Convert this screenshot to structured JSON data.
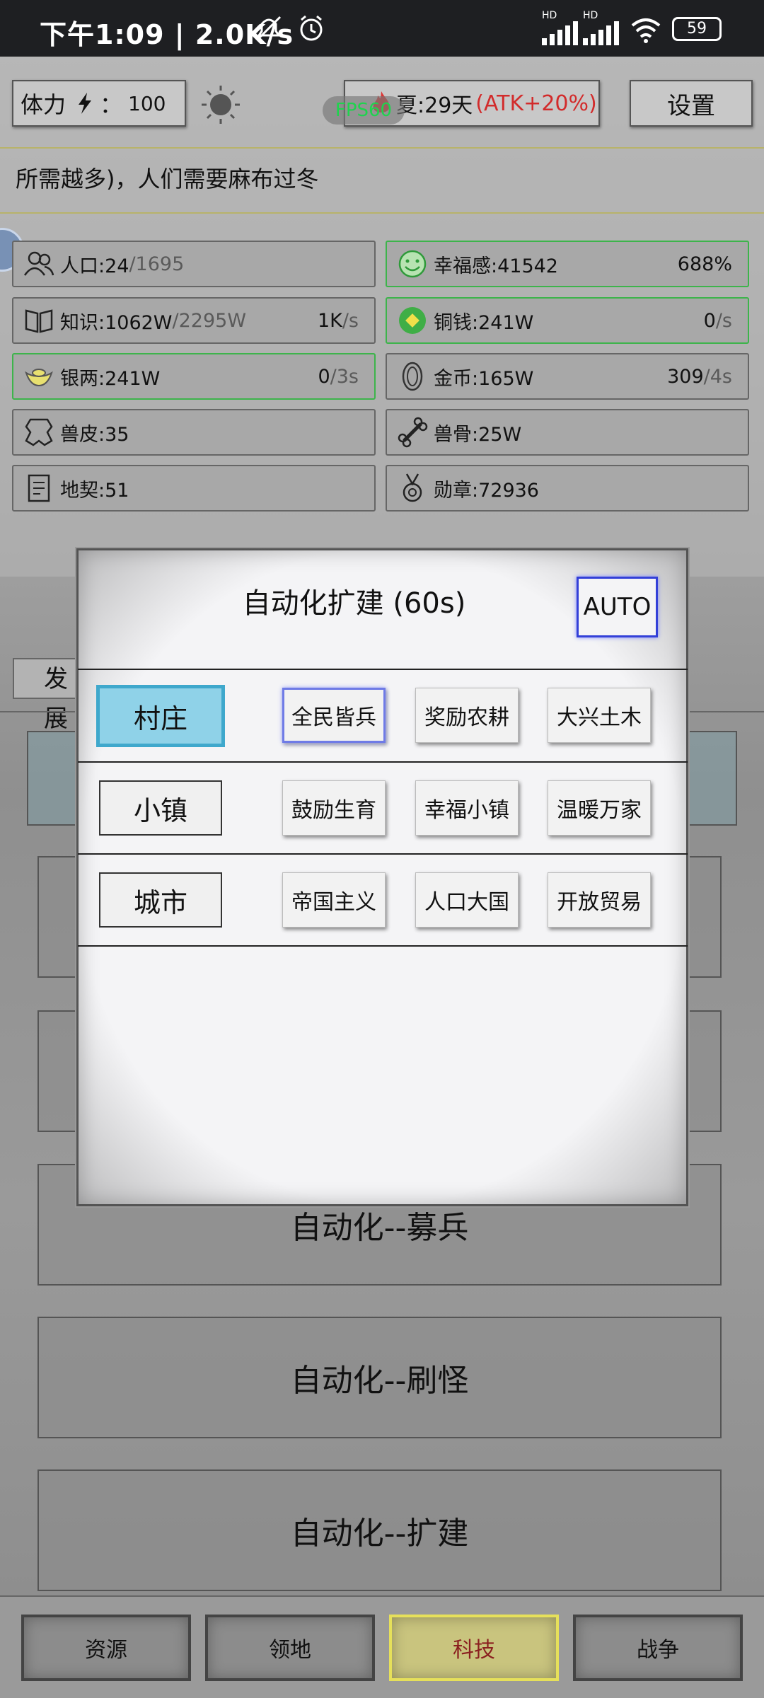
{
  "status_bar": {
    "time": "下午1:09 | 2.0K/s",
    "network_1": "HD",
    "network_2": "HD",
    "battery": "59"
  },
  "header": {
    "stamina_label": "体力",
    "stamina_sep": "：",
    "stamina_value": "100",
    "season": "夏:29天",
    "season_bonus": "(ATK+20%)",
    "settings_label": "设置",
    "fps": "FPS60"
  },
  "ticker": "所需越多)，人们需要麻布过冬",
  "stats": [
    {
      "label": "人口:24",
      "suffix": "/1695",
      "rate": "",
      "rate_suffix": "",
      "icon": "people-icon"
    },
    {
      "label": "幸福感:41542",
      "suffix": "",
      "rate": "688%",
      "rate_suffix": "",
      "icon": "smile-icon"
    },
    {
      "label": "知识:1062W",
      "suffix": "/2295W",
      "rate": "1K",
      "rate_suffix": "/s",
      "icon": "book-icon"
    },
    {
      "label": "铜钱:241W",
      "suffix": "",
      "rate": "0",
      "rate_suffix": "/s",
      "icon": "coin-icon"
    },
    {
      "label": "银两:241W",
      "suffix": "",
      "rate": "0",
      "rate_suffix": "/3s",
      "icon": "silver-ingot-icon"
    },
    {
      "label": "金币:165W",
      "suffix": "",
      "rate": "309",
      "rate_suffix": "/4s",
      "icon": "gold-coin-icon"
    },
    {
      "label": "兽皮:35",
      "suffix": "",
      "rate": "",
      "rate_suffix": "",
      "icon": "hide-icon"
    },
    {
      "label": "兽骨:25W",
      "suffix": "",
      "rate": "",
      "rate_suffix": "",
      "icon": "bone-icon"
    },
    {
      "label": "地契:51",
      "suffix": "",
      "rate": "",
      "rate_suffix": "",
      "icon": "deed-icon"
    },
    {
      "label": "勋章:72936",
      "suffix": "",
      "rate": "",
      "rate_suffix": "",
      "icon": "medal-icon"
    }
  ],
  "under": {
    "tab_fragment": "发展",
    "buttons": [
      "自动化--募兵",
      "自动化--刷怪",
      "自动化--扩建"
    ]
  },
  "modal": {
    "title": "自动化扩建 (60s)",
    "auto_label": "AUTO",
    "rows": [
      {
        "name": "村庄",
        "options": [
          "全民皆兵",
          "奖励农耕",
          "大兴土木"
        ]
      },
      {
        "name": "小镇",
        "options": [
          "鼓励生育",
          "幸福小镇",
          "温暖万家"
        ]
      },
      {
        "name": "城市",
        "options": [
          "帝国主义",
          "人口大国",
          "开放贸易"
        ]
      }
    ]
  },
  "bottom_nav": [
    "资源",
    "领地",
    "科技",
    "战争"
  ],
  "colors": {
    "accent_blue": "#3340d8",
    "selected_cyan": "#3fa8cc",
    "stat_green": "#3db44b",
    "fps_green": "#1fd34e",
    "season_red": "#d22b2b",
    "nav_active": "#e6e05a"
  }
}
